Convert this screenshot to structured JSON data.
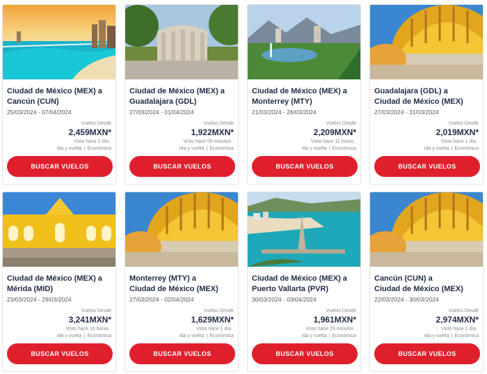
{
  "deals": [
    {
      "origin": "Ciudad de México (MEX) a",
      "destination": "Cancún (CUN)",
      "dates": "25/03/2024 - 07/04/2024",
      "from_label": "Vuelos Desde",
      "price": "2,459MXN*",
      "seen": "Visto hace 1 día .",
      "trip_type": "Ida y vuelta",
      "cabin": "Económica",
      "button": "BUSCAR VUELOS",
      "image": "cancun-beach-image"
    },
    {
      "origin": "Ciudad de México (MEX) a",
      "destination": "Guadalajara (GDL)",
      "dates": "27/03/2024 - 01/04/2024",
      "from_label": "Vuelos Desde",
      "price": "1,922MXN*",
      "seen": "Visto hace 55 minutos .",
      "trip_type": "Ida y vuelta",
      "cabin": "Económica",
      "button": "BUSCAR VUELOS",
      "image": "guadalajara-rotunda-image"
    },
    {
      "origin": "Ciudad de México (MEX) a",
      "destination": "Monterrey (MTY)",
      "dates": "21/03/2024 - 26/03/2024",
      "from_label": "Vuelos Desde",
      "price": "2,209MXN*",
      "seen": "Visto hace 11 horas .",
      "trip_type": "Ida y vuelta",
      "cabin": "Económica",
      "button": "BUSCAR VUELOS",
      "image": "monterrey-park-image"
    },
    {
      "origin": "Guadalajara (GDL) a",
      "destination": "Ciudad de México (MEX)",
      "dates": "27/03/2024 - 31/03/2024",
      "from_label": "Vuelos Desde",
      "price": "2,019MXN*",
      "seen": "Visto hace 1 día .",
      "trip_type": "Ida y vuelta",
      "cabin": "Económica",
      "button": "BUSCAR VUELOS",
      "image": "bellas-artes-dome-image"
    },
    {
      "origin": "Ciudad de México (MEX) a",
      "destination": "Mérida (MID)",
      "dates": "23/03/2024 - 29/03/2024",
      "from_label": "Vuelos Desde",
      "price": "3,241MXN*",
      "seen": "Visto hace 10 horas .",
      "trip_type": "Ida y vuelta",
      "cabin": "Económica",
      "button": "BUSCAR VUELOS",
      "image": "izamal-yellow-convent-image"
    },
    {
      "origin": "Monterrey (MTY) a",
      "destination": "Ciudad de México (MEX)",
      "dates": "27/03/2024 - 02/04/2024",
      "from_label": "Vuelos Desde",
      "price": "1,629MXN*",
      "seen": "Visto hace 1 día .",
      "trip_type": "Ida y vuelta",
      "cabin": "Económica",
      "button": "BUSCAR VUELOS",
      "image": "bellas-artes-dome-image"
    },
    {
      "origin": "Ciudad de México (MEX) a",
      "destination": "Puerto Vallarta (PVR)",
      "dates": "30/03/2024 - 03/04/2024",
      "from_label": "Vuelos Desde",
      "price": "1,961MXN*",
      "seen": "Visto hace 29 minutos .",
      "trip_type": "Ida y vuelta",
      "cabin": "Económica",
      "button": "BUSCAR VUELOS",
      "image": "puerto-vallarta-pier-image"
    },
    {
      "origin": "Cancún (CUN) a",
      "destination": "Ciudad de México (MEX)",
      "dates": "22/03/2024 - 30/03/2024",
      "from_label": "Vuelos Desde",
      "price": "2,974MXN*",
      "seen": "Visto hace 1 día .",
      "trip_type": "Ida y vuelta",
      "cabin": "Económica",
      "button": "BUSCAR VUELOS",
      "image": "bellas-artes-dome-image"
    }
  ],
  "colors": {
    "button": "#e01f2d",
    "title": "#1f2a44"
  }
}
